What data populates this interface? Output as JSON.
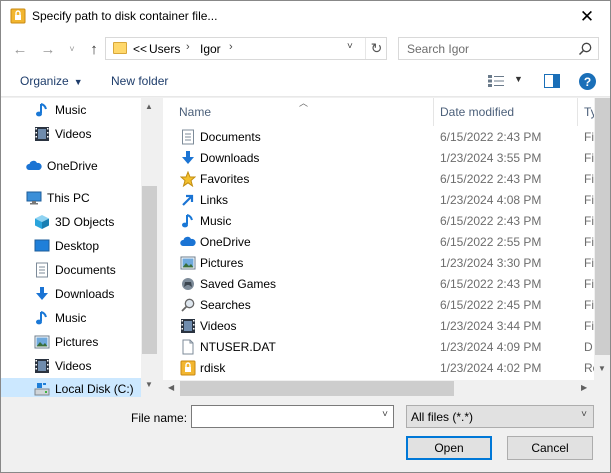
{
  "window": {
    "title": "Specify path to disk container file...",
    "close_glyph": "✕"
  },
  "address": {
    "overflow": "<<",
    "crumbs": [
      "Users",
      "Igor"
    ],
    "search_placeholder": "Search Igor"
  },
  "toolbar": {
    "organize": "Organize",
    "new_folder": "New folder",
    "help": "?"
  },
  "nav_pane": {
    "items": [
      {
        "label": "Music",
        "icon": "music-icon"
      },
      {
        "label": "Videos",
        "icon": "video-icon"
      },
      {
        "label": "OneDrive",
        "icon": "cloud-icon"
      },
      {
        "label": "This PC",
        "icon": "pc-icon"
      },
      {
        "label": "3D Objects",
        "icon": "cube-icon"
      },
      {
        "label": "Desktop",
        "icon": "desktop-icon"
      },
      {
        "label": "Documents",
        "icon": "document-icon"
      },
      {
        "label": "Downloads",
        "icon": "download-icon"
      },
      {
        "label": "Music",
        "icon": "music-icon"
      },
      {
        "label": "Pictures",
        "icon": "picture-icon"
      },
      {
        "label": "Videos",
        "icon": "video-icon"
      },
      {
        "label": "Local Disk (C:)",
        "icon": "disk-icon",
        "selected": true
      }
    ]
  },
  "file_list": {
    "columns": {
      "name": "Name",
      "date": "Date modified",
      "type": "Ty"
    },
    "rows": [
      {
        "name": "Documents",
        "date": "6/15/2022 2:43 PM",
        "type": "Fi",
        "icon": "document-icon"
      },
      {
        "name": "Downloads",
        "date": "1/23/2024 3:55 PM",
        "type": "Fi",
        "icon": "download-icon"
      },
      {
        "name": "Favorites",
        "date": "6/15/2022 2:43 PM",
        "type": "Fi",
        "icon": "star-icon"
      },
      {
        "name": "Links",
        "date": "1/23/2024 4:08 PM",
        "type": "Fi",
        "icon": "link-icon"
      },
      {
        "name": "Music",
        "date": "6/15/2022 2:43 PM",
        "type": "Fi",
        "icon": "music-icon"
      },
      {
        "name": "OneDrive",
        "date": "6/15/2022 2:55 PM",
        "type": "Fi",
        "icon": "cloud-icon"
      },
      {
        "name": "Pictures",
        "date": "1/23/2024 3:30 PM",
        "type": "Fi",
        "icon": "picture-icon"
      },
      {
        "name": "Saved Games",
        "date": "6/15/2022 2:43 PM",
        "type": "Fi",
        "icon": "gamepad-icon"
      },
      {
        "name": "Searches",
        "date": "6/15/2022 2:45 PM",
        "type": "Fi",
        "icon": "search-icon"
      },
      {
        "name": "Videos",
        "date": "1/23/2024 3:44 PM",
        "type": "Fi",
        "icon": "video-icon"
      },
      {
        "name": "NTUSER.DAT",
        "date": "1/23/2024 4:09 PM",
        "type": "D",
        "icon": "file-icon"
      },
      {
        "name": "rdisk",
        "date": "1/23/2024 4:02 PM",
        "type": "Ro",
        "icon": "lock-file-icon"
      }
    ]
  },
  "bottom": {
    "file_name_label": "File name:",
    "file_name_value": "",
    "filter_value": "All files (*.*)",
    "open_label": "Open",
    "cancel_label": "Cancel"
  },
  "colors": {
    "selection": "#cce8ff",
    "accent": "#0078d7",
    "link_text": "#1e3d6b"
  }
}
